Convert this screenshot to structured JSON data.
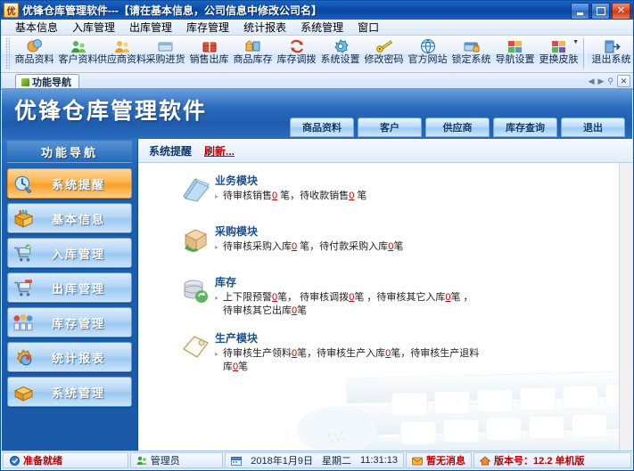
{
  "window": {
    "app_short": "优",
    "title": "优锋仓库管理软件---【请在基本信息，公司信息中修改公司名】",
    "minimize": "_",
    "maximize": "□",
    "close": "✕"
  },
  "menubar": {
    "items": [
      {
        "label": "基本信息"
      },
      {
        "label": "入库管理"
      },
      {
        "label": "出库管理"
      },
      {
        "label": "库存管理"
      },
      {
        "label": "统计报表"
      },
      {
        "label": "系统管理"
      },
      {
        "label": "窗口"
      }
    ]
  },
  "toolbar": {
    "buttons": [
      {
        "label": "商品资料",
        "icon": "goods-icon"
      },
      {
        "label": "客户资料",
        "icon": "customer-icon"
      },
      {
        "label": "供应商资料",
        "icon": "supplier-icon"
      },
      {
        "label": "采购进货",
        "icon": "purchase-icon"
      },
      {
        "label": "销售出库",
        "icon": "sales-icon"
      },
      {
        "label": "商品库存",
        "icon": "stock-icon"
      },
      {
        "label": "库存调拨",
        "icon": "transfer-icon"
      },
      {
        "label": "系统设置",
        "icon": "settings-icon"
      },
      {
        "label": "修改密码",
        "icon": "password-icon"
      },
      {
        "label": "官方网站",
        "icon": "website-icon"
      },
      {
        "label": "锁定系统",
        "icon": "lock-icon"
      },
      {
        "label": "导航设置",
        "icon": "navigation-icon"
      },
      {
        "label": "更换皮肤",
        "icon": "skin-icon",
        "has_dropdown": true
      },
      {
        "label": "退出系统",
        "icon": "exit-icon"
      }
    ]
  },
  "tabstrip": {
    "tabs": [
      {
        "label": "功能导航"
      }
    ],
    "prev": "◀",
    "next": "▶",
    "pin": "⚲",
    "close": "✕"
  },
  "banner": {
    "title": "优锋仓库管理软件",
    "navtabs": [
      {
        "label": "商品资料"
      },
      {
        "label": "客户"
      },
      {
        "label": "供应商"
      },
      {
        "label": "库存查询"
      },
      {
        "label": "退出"
      }
    ]
  },
  "sidebar": {
    "header": "功能导航",
    "items": [
      {
        "label": "系统提醒",
        "icon": "reminder-icon",
        "active": true
      },
      {
        "label": "基本信息",
        "icon": "basic-info-icon",
        "active": false
      },
      {
        "label": "入库管理",
        "icon": "inbound-icon",
        "active": false
      },
      {
        "label": "出库管理",
        "icon": "outbound-icon",
        "active": false
      },
      {
        "label": "库存管理",
        "icon": "inventory-icon",
        "active": false
      },
      {
        "label": "统计报表",
        "icon": "report-icon",
        "active": false
      },
      {
        "label": "系统管理",
        "icon": "system-icon",
        "active": false
      }
    ]
  },
  "content": {
    "header_title": "系统提醒",
    "refresh_link": "刷新...",
    "modules": [
      {
        "title": "业务模块",
        "icon": "book-icon",
        "lines": [
          {
            "parts": [
              {
                "t": "待审核销售"
              },
              {
                "n": "0"
              },
              {
                "t": " 笔，待收款销售"
              },
              {
                "n": "0"
              },
              {
                "t": " 笔"
              }
            ]
          }
        ]
      },
      {
        "title": "采购模块",
        "icon": "box-icon",
        "lines": [
          {
            "parts": [
              {
                "t": "待审核采购入库"
              },
              {
                "n": "0"
              },
              {
                "t": " 笔，待付款采购入库"
              },
              {
                "n": "0"
              },
              {
                "t": "笔"
              }
            ]
          }
        ]
      },
      {
        "title": "库存",
        "icon": "database-icon",
        "lines": [
          {
            "parts": [
              {
                "t": "上下限预警"
              },
              {
                "n": "0"
              },
              {
                "t": "笔， 待审核调拨"
              },
              {
                "n": "0"
              },
              {
                "t": "笔 ，待审核其它入库"
              },
              {
                "n": "0"
              },
              {
                "t": "笔 ，待审核其它出库"
              },
              {
                "n": "0"
              },
              {
                "t": "笔"
              }
            ]
          }
        ]
      },
      {
        "title": "生产模块",
        "icon": "production-icon",
        "lines": [
          {
            "parts": [
              {
                "t": "待审核生产领料"
              },
              {
                "n": "0"
              },
              {
                "t": "笔，待审核生产入库"
              },
              {
                "n": "0"
              },
              {
                "t": "笔，待审核生产退料库"
              },
              {
                "n": "0"
              },
              {
                "t": "笔"
              }
            ]
          }
        ]
      }
    ]
  },
  "statusbar": {
    "ready": "准备就绪",
    "user": "管理员",
    "date": "2018年1月9日",
    "weekday": "星期二",
    "time": "11:31:13",
    "message": "暂无消息",
    "version": "版本号：12.2 单机版"
  },
  "colors": {
    "title_blue": "#0b4aa8",
    "accent_orange": "#f79e28",
    "link_red": "#c00000",
    "banner_blue": "#2c6fc0"
  }
}
